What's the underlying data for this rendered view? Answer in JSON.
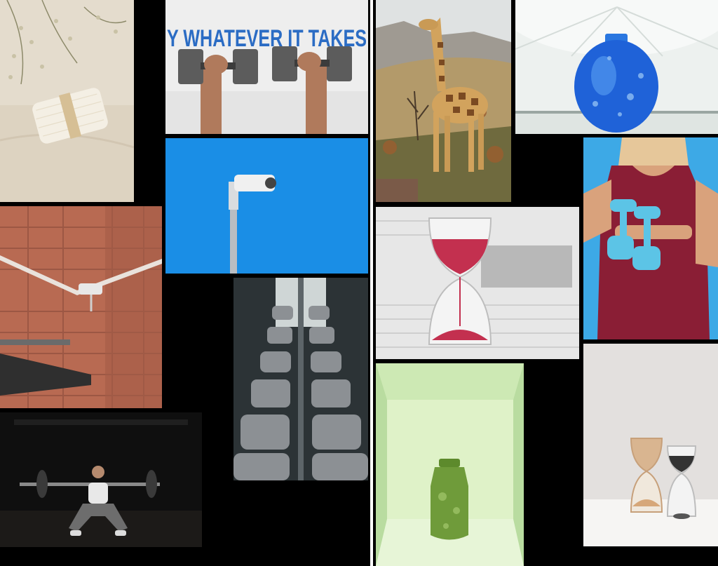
{
  "collage": {
    "photos": [
      {
        "name": "cotton-swabs-photo",
        "subject": "bundle of cotton swabs with dried flowers"
      },
      {
        "name": "dumbbells-lift-photo",
        "subject": "arms lifting two dumbbells below a wall slogan",
        "wall_text": "Y WHATEVER IT TAKES"
      },
      {
        "name": "giraffe-photo",
        "subject": "giraffe standing on savanna hillside"
      },
      {
        "name": "blue-vase-photo",
        "subject": "blue bubble-glass vase in white gallery"
      },
      {
        "name": "brick-camera-photo",
        "subject": "security camera on terracotta tiled corner"
      },
      {
        "name": "sky-camera-photo",
        "subject": "security camera on pole against blue sky"
      },
      {
        "name": "woman-dumbbells-photo",
        "subject": "woman in red top holding light blue dumbbells"
      },
      {
        "name": "hourglass-newspaper-photo",
        "subject": "hourglass with red sand on newspaper"
      },
      {
        "name": "dumbbell-rack-photo",
        "subject": "rows of dumbbells on gym rack"
      },
      {
        "name": "squat-photo",
        "subject": "woman squatting with barbell in dark gym"
      },
      {
        "name": "green-vase-photo",
        "subject": "green glass vase in light green box"
      },
      {
        "name": "two-hourglasses-photo",
        "subject": "two hourglasses on white table"
      }
    ],
    "colors": {
      "background": "#000000",
      "divider": "#ffffff",
      "sky_blue": "#1a8ee6",
      "brick": "#b86a52",
      "slogan_blue": "#2b6cc4",
      "sand_red": "#c3304f"
    }
  }
}
